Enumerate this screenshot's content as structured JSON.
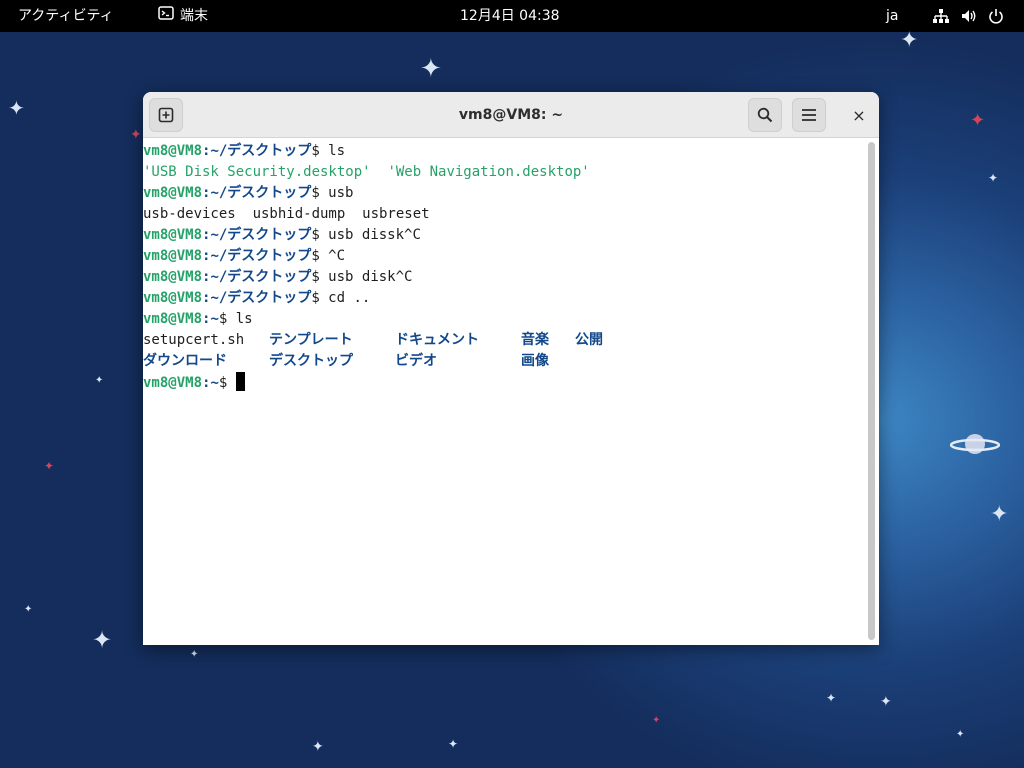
{
  "topbar": {
    "activities": "アクティビティ",
    "app_name": "端末",
    "clock": "12月4日  04:38",
    "lang": "ja",
    "icons": [
      "network-icon",
      "volume-icon",
      "power-icon"
    ]
  },
  "window": {
    "title": "vm8@VM8: ~",
    "buttons": [
      "new-tab-icon",
      "search-icon",
      "hamburger-menu-icon",
      "close-icon"
    ],
    "close_glyph": "×"
  },
  "terminal": {
    "prompt_user": "vm8@VM8",
    "lines": {
      "l1": {
        "path": ":~/デスクトップ",
        "cmd": "$ ls"
      },
      "l2": {
        "a": "'USB Disk Security.desktop'",
        "gap": "  ",
        "b": "'Web Navigation.desktop'"
      },
      "l3": {
        "path": ":~/デスクトップ",
        "cmd": "$ usb"
      },
      "l4": {
        "text": "usb-devices  usbhid-dump  usbreset"
      },
      "l5": {
        "path": ":~/デスクトップ",
        "cmd": "$ usb dissk^C"
      },
      "l6": {
        "path": ":~/デスクトップ",
        "cmd": "$ ^C"
      },
      "l7": {
        "path": ":~/デスクトップ",
        "cmd": "$ usb disk^C"
      },
      "l8": {
        "path": ":~/デスクトップ",
        "cmd": "$ cd .."
      },
      "l9": {
        "path": ":~",
        "cmd": "$ ls"
      },
      "l10": {
        "file": "setupcert.sh",
        "d1": "テンプレート",
        "d2": "ドキュメント",
        "d3": "音楽",
        "d4": "公開"
      },
      "l11": {
        "d1": "ダウンロード",
        "d2": "デスクトップ",
        "d3": "ビデオ",
        "d4": "画像"
      },
      "l12": {
        "path": ":~",
        "cmd": "$ "
      }
    }
  },
  "colors": {
    "prompt_green": "#26a269",
    "dir_blue": "#12488b",
    "topbar": "#000000",
    "header": "#ebebeb"
  }
}
